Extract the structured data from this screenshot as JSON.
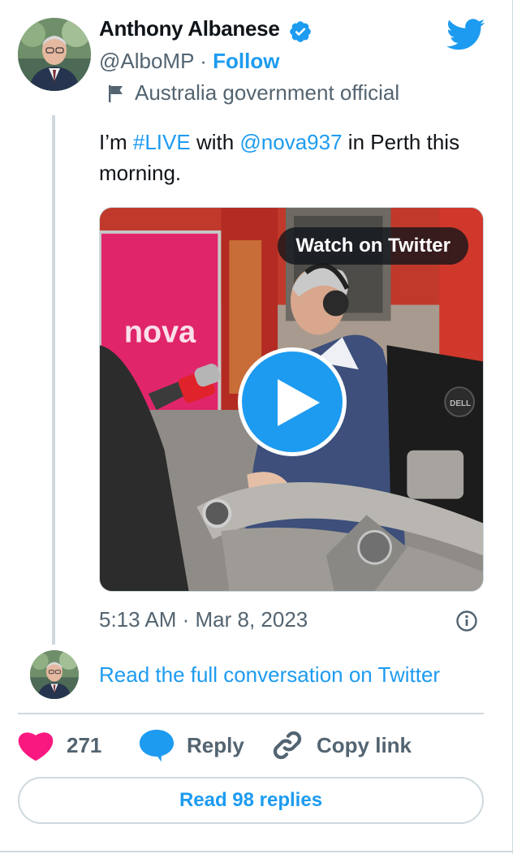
{
  "author": {
    "name": "Anthony Albanese",
    "handle": "@AlboMP",
    "separator": "·",
    "follow_label": "Follow",
    "label": "Australia government official"
  },
  "tweet": {
    "text_parts": [
      "I’m ",
      "#LIVE",
      " with ",
      "@nova937",
      " in Perth this morning."
    ],
    "timestamp": "5:13 AM · Mar 8, 2023"
  },
  "media": {
    "watch_label": "Watch on Twitter",
    "sign_text": "nova",
    "monitor_brand": "DELL"
  },
  "conversation": {
    "read_full_label": "Read the full conversation on Twitter"
  },
  "actions": {
    "like_count": "271",
    "reply_label": "Reply",
    "copy_link_label": "Copy link",
    "read_replies_label": "Read 98 replies"
  },
  "colors": {
    "accent": "#1d9bf0",
    "like": "#f91880",
    "text_primary": "#0f1419",
    "text_secondary": "#536471",
    "border": "#cfd9de"
  }
}
